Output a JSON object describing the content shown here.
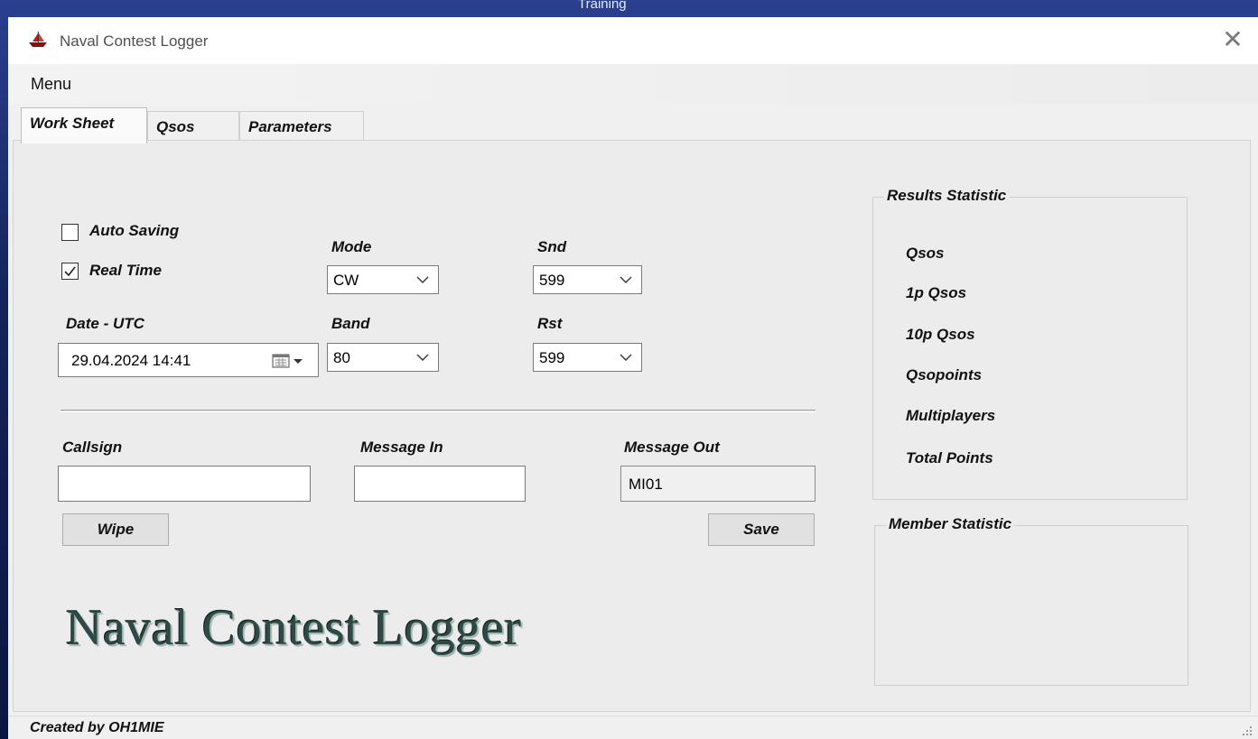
{
  "desktop": {
    "caption": "Training"
  },
  "window": {
    "title": "Naval Contest Logger",
    "close_symbol": "✕"
  },
  "menu": {
    "items": [
      "Menu"
    ]
  },
  "tabs": [
    {
      "label": "Work Sheet",
      "active": true
    },
    {
      "label": "Qsos",
      "active": false
    },
    {
      "label": "Parameters",
      "active": false
    }
  ],
  "worksheet": {
    "auto_saving": {
      "label": "Auto Saving",
      "checked": false
    },
    "real_time": {
      "label": "Real Time",
      "checked": true
    },
    "mode": {
      "label": "Mode",
      "value": "CW"
    },
    "snd": {
      "label": "Snd",
      "value": "599"
    },
    "date": {
      "label": "Date - UTC",
      "value": "29.04.2024 14:41"
    },
    "band": {
      "label": "Band",
      "value": "80"
    },
    "rst": {
      "label": "Rst",
      "value": "599"
    },
    "callsign": {
      "label": "Callsign",
      "value": ""
    },
    "message_in": {
      "label": "Message In",
      "value": ""
    },
    "message_out": {
      "label": "Message Out",
      "value": "MI01"
    },
    "wipe_label": "Wipe",
    "save_label": "Save",
    "logo_text": "Naval Contest Logger"
  },
  "results": {
    "title": "Results Statistic",
    "items": [
      "Qsos",
      "1p   Qsos",
      "10p Qsos",
      "Qsopoints",
      "Multiplayers",
      "Total Points"
    ]
  },
  "member": {
    "title": "Member Statistic"
  },
  "status": {
    "text": "Created by OH1MIE"
  },
  "colors": {
    "desktop": "#14245a",
    "logo_text": "#2f4a46",
    "panel": "#ececec"
  }
}
